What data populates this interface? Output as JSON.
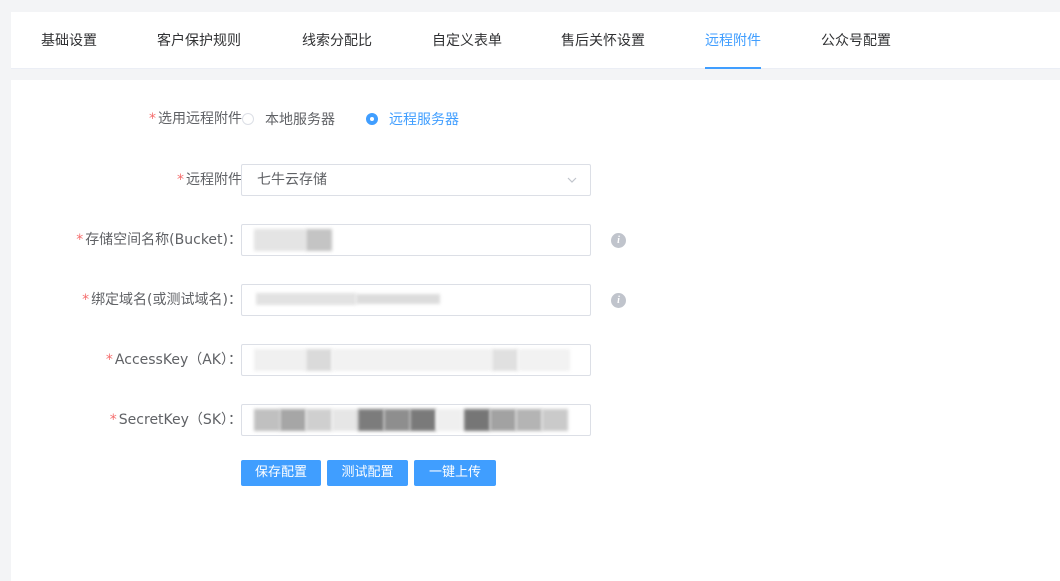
{
  "tabs": [
    {
      "label": "基础设置"
    },
    {
      "label": "客户保护规则"
    },
    {
      "label": "线索分配比"
    },
    {
      "label": "自定义表单"
    },
    {
      "label": "售后关怀设置"
    },
    {
      "label": "远程附件",
      "active": true
    },
    {
      "label": "公众号配置"
    }
  ],
  "form": {
    "remote_select": {
      "required_mark": "*",
      "label": "选用远程附件",
      "options": [
        {
          "label": "本地服务器",
          "checked": false
        },
        {
          "label": "远程服务器",
          "checked": true
        }
      ]
    },
    "remote_attachment": {
      "required_mark": "*",
      "label": "远程附件",
      "value": "七牛云存储"
    },
    "bucket": {
      "required_mark": "*",
      "label": "存储空间名称(Bucket)：",
      "value": ""
    },
    "domain": {
      "required_mark": "*",
      "label": "绑定域名(或测试域名)：",
      "value": ""
    },
    "access_key": {
      "required_mark": "*",
      "label": "AccessKey（AK）：",
      "value": ""
    },
    "secret_key": {
      "required_mark": "*",
      "label": "SecretKey（SK）：",
      "value": ""
    }
  },
  "buttons": {
    "save": "保存配置",
    "test": "测试配置",
    "upload": "一键上传"
  },
  "icons": {
    "info": "info-icon",
    "dropdown": "chevron-down-icon"
  },
  "colors": {
    "accent": "#409eff",
    "required": "#f56c6c",
    "text": "#606266",
    "page_bg": "#f3f4f6"
  }
}
